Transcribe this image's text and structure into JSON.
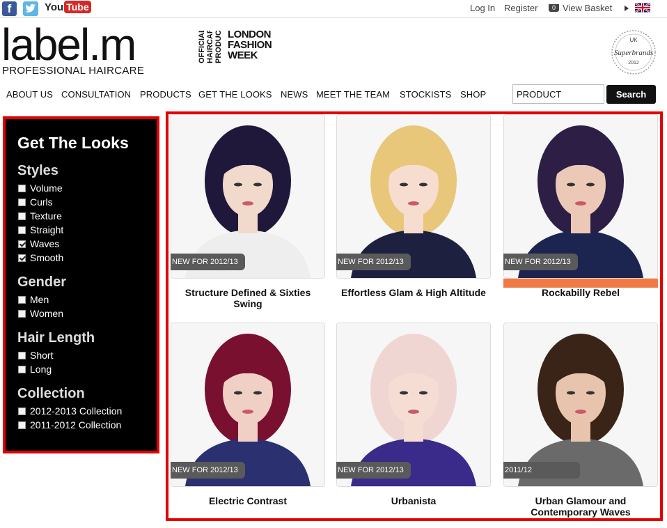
{
  "topbar": {
    "social": {
      "facebook": "f",
      "twitter": "twitter-icon",
      "youtube_you": "You",
      "youtube_tube": "Tube"
    },
    "login": "Log In",
    "register": "Register",
    "basket_count": "0",
    "basket": "View Basket"
  },
  "header": {
    "logo": "label.m",
    "logo_sub": "PROFESSIONAL HAIRCARE",
    "official_lines": [
      "OFFICIAL",
      "HAIRCARE",
      "PRODUCT"
    ],
    "lfw_lines": [
      "LONDON",
      "FASHION",
      "WEEK"
    ],
    "superbrands": {
      "top": "UK",
      "mid": "Superbrands",
      "year": "2012"
    }
  },
  "nav": {
    "items": [
      "ABOUT US",
      "CONSULTATION",
      "PRODUCTS",
      "GET THE LOOKS",
      "NEWS",
      "MEET THE TEAM",
      "STOCKISTS",
      "SHOP"
    ],
    "search_value": "PRODUCT",
    "search_button": "Search"
  },
  "sidebar": {
    "title": "Get The Looks",
    "styles_label": "Styles",
    "styles": [
      {
        "label": "Volume",
        "checked": false
      },
      {
        "label": "Curls",
        "checked": false
      },
      {
        "label": "Texture",
        "checked": false
      },
      {
        "label": "Straight",
        "checked": false
      },
      {
        "label": "Waves",
        "checked": true
      },
      {
        "label": "Smooth",
        "checked": true
      }
    ],
    "gender_label": "Gender",
    "gender": [
      {
        "label": "Men",
        "checked": false
      },
      {
        "label": "Women",
        "checked": false
      }
    ],
    "length_label": "Hair Length",
    "length": [
      {
        "label": "Short",
        "checked": false
      },
      {
        "label": "Long",
        "checked": false
      }
    ],
    "collection_label": "Collection",
    "collection": [
      {
        "label": "2012-2013 Collection",
        "checked": false
      },
      {
        "label": "2011-2012 Collection",
        "checked": false
      }
    ]
  },
  "looks": [
    {
      "title": "Structure Defined & Sixties Swing",
      "badge": "NEW FOR 2012/13",
      "hair": "#20183a",
      "skin": "#f1d9cc",
      "top": "#eeeeee"
    },
    {
      "title": "Effortless Glam & High Altitude",
      "badge": "NEW FOR 2012/13",
      "hair": "#e8c77a",
      "skin": "#f6ddd0",
      "top": "#1e2040"
    },
    {
      "title": "Rockabilly Rebel",
      "badge": "NEW FOR 2012/13",
      "hair": "#2c1e44",
      "skin": "#ecc9b6",
      "top": "#1b2550"
    },
    {
      "title": "Electric Contrast",
      "badge": "NEW FOR 2012/13",
      "hair": "#7a1030",
      "skin": "#f0d0c4",
      "top": "#2a3070"
    },
    {
      "title": "Urbanista",
      "badge": "NEW FOR 2012/13",
      "hair": "#f0d6d2",
      "skin": "#f5ddd4",
      "top": "#3a2a8a"
    },
    {
      "title": "Urban Glamour and Contemporary Waves",
      "badge": "2011/12",
      "hair": "#3a2418",
      "skin": "#e8c4ae",
      "top": "#6a6a6a"
    }
  ],
  "colors": {
    "accent": "#e30000",
    "hover_bar": "#f07a45",
    "badge": "#5a5a5a"
  }
}
